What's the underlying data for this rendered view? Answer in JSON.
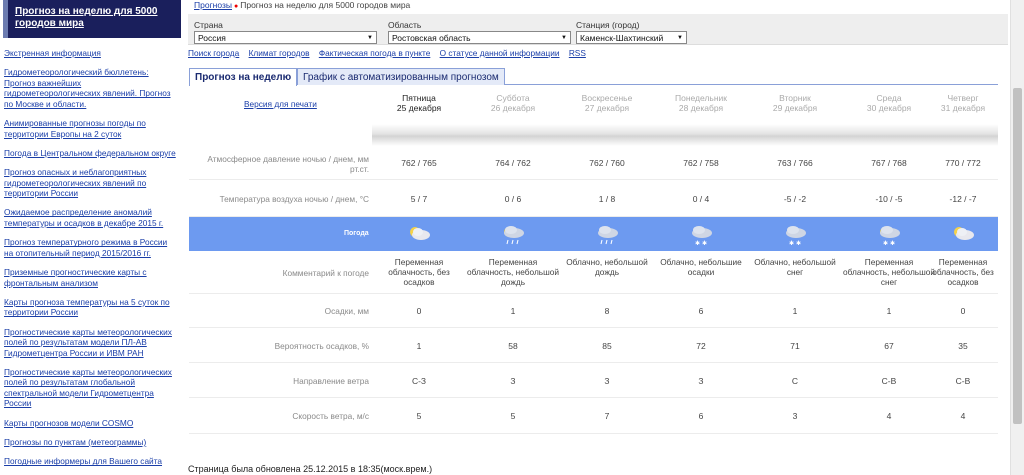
{
  "sidebar": {
    "title": "Прогноз на неделю для 5000 городов мира",
    "items": [
      "Экстренная информация",
      "Гидрометеорологический бюллетень: Прогноз важнейших гидрометеорологических явлений. Прогноз по Москве и области.",
      "Анимированные прогнозы погоды по территории Европы на 2 суток",
      "Погода в Центральном федеральном округе",
      "Прогноз опасных и неблагоприятных гидрометеорологических явлений по территории России",
      "Ожидаемое распределение аномалий температуры и осадков в декабре 2015 г.",
      "Прогноз температурного режима в России на отопительный период 2015/2016 гг.",
      "Приземные прогностические карты с фронтальным анализом",
      "Карты прогноза температуры на 5 суток по территории России",
      "Прогностические карты метеорологических полей по результатам модели ПЛ-АВ Гидрометцентра России и ИВМ РАН",
      "Прогностические карты метеорологических полей по результатам глобальной спектральной модели Гидрометцентра России",
      "Карты прогнозов модели COSMO",
      "Прогнозы по пунктам (метеограммы)",
      "Погодные информеры для Вашего сайта"
    ]
  },
  "breadcrumb": {
    "link": "Прогнозы",
    "current": "Прогноз на неделю для 5000 городов мира"
  },
  "filters": {
    "country_label": "Страна",
    "country_value": "Россия",
    "region_label": "Область",
    "region_value": "Ростовская область",
    "station_label": "Станция (город)",
    "station_value": "Каменск-Шахтинский"
  },
  "links": [
    "Поиск города",
    "Климат городов",
    "Фактическая погода в пункте",
    "О статусе данной информации",
    "RSS"
  ],
  "tabs": [
    "Прогноз на неделю",
    "График с автоматизированным прогнозом"
  ],
  "print_link": "Версия для печати",
  "labels": {
    "pressure": "Атмосферное давление ночью / днем, мм рт.ст.",
    "temperature": "Температура воздуха ночью / днем, °С",
    "weather": "Погода",
    "comment": "Комментарий к погоде",
    "precip": "Осадки, мм",
    "prob": "Вероятность осадков, %",
    "wind_dir": "Направление ветра",
    "wind_speed": "Скорость ветра, м/с"
  },
  "days": [
    {
      "name": "Пятница",
      "date": "25 декабря",
      "pressure": "762 / 765",
      "temp": "5 / 7",
      "icon": "cloud-sun-icon",
      "comment": "Переменная облачность, без осадков",
      "precip": "0",
      "prob": "1",
      "wind_dir": "С-З",
      "wind_speed": "5"
    },
    {
      "name": "Суббота",
      "date": "26 декабря",
      "pressure": "764 / 762",
      "temp": "0 / 6",
      "icon": "cloud-sun-rain-icon",
      "comment": "Переменная облачность, небольшой дождь",
      "precip": "1",
      "prob": "58",
      "wind_dir": "З",
      "wind_speed": "5"
    },
    {
      "name": "Воскресенье",
      "date": "27 декабря",
      "pressure": "762 / 760",
      "temp": "1 / 8",
      "icon": "cloud-rain-icon",
      "comment": "Облачно, небольшой дождь",
      "precip": "8",
      "prob": "85",
      "wind_dir": "З",
      "wind_speed": "7"
    },
    {
      "name": "Понедельник",
      "date": "28 декабря",
      "pressure": "762 / 758",
      "temp": "0 / 4",
      "icon": "cloud-snow-icon",
      "comment": "Облачно, небольшие осадки",
      "precip": "6",
      "prob": "72",
      "wind_dir": "З",
      "wind_speed": "6"
    },
    {
      "name": "Вторник",
      "date": "29 декабря",
      "pressure": "763 / 766",
      "temp": "-5 / -2",
      "icon": "cloud-snow-icon",
      "comment": "Облачно, небольшой снег",
      "precip": "1",
      "prob": "71",
      "wind_dir": "С",
      "wind_speed": "3"
    },
    {
      "name": "Среда",
      "date": "30 декабря",
      "pressure": "767 / 768",
      "temp": "-10 / -5",
      "icon": "cloud-sun-snow-icon",
      "comment": "Переменная облачность, небольшой снег",
      "precip": "1",
      "prob": "67",
      "wind_dir": "С-В",
      "wind_speed": "4"
    },
    {
      "name": "Четверг",
      "date": "31 декабря",
      "pressure": "770 / 772",
      "temp": "-12 / -7",
      "icon": "cloud-sun-icon",
      "comment": "Переменная облачность, без осадков",
      "precip": "0",
      "prob": "35",
      "wind_dir": "С-В",
      "wind_speed": "4"
    }
  ],
  "footer": "Страница была обновлена 25.12.2015 в 18:35(моск.врем.)",
  "colors": {
    "band": "#6d9af0",
    "sidebar_head": "#1a1f5c",
    "link": "#1a3ea8"
  }
}
